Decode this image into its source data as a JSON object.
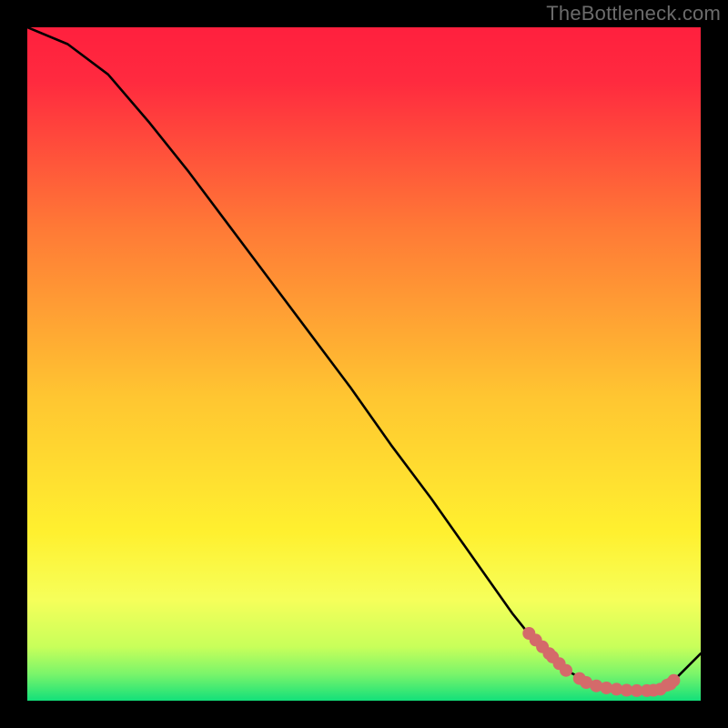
{
  "attribution": "TheBottleneck.com",
  "colors": {
    "gradient_top": "#ff203e",
    "gradient_mid": "#ffd231",
    "gradient_low": "#f6ff5a",
    "gradient_bottom": "#13e07a",
    "curve": "#000000",
    "marker": "#d46a6a",
    "frame": "#000000"
  },
  "chart_data": {
    "type": "line",
    "title": "",
    "xlabel": "",
    "ylabel": "",
    "x_range": [
      0,
      100
    ],
    "y_range": [
      0,
      100
    ],
    "curve": {
      "x": [
        0,
        6,
        12,
        18,
        24,
        30,
        36,
        42,
        48,
        54,
        60,
        66,
        72,
        76,
        80,
        84,
        88,
        92,
        96,
        100
      ],
      "y": [
        100,
        97.5,
        93,
        86,
        78.5,
        70.5,
        62.5,
        54.5,
        46.5,
        38,
        30,
        21.5,
        13,
        8,
        4.5,
        2.5,
        1.5,
        1.5,
        3,
        7
      ]
    },
    "markers": {
      "x": [
        74.5,
        75.5,
        76.5,
        77.5,
        78,
        79,
        80,
        82,
        83,
        84.5,
        86,
        87.5,
        89,
        90.5,
        92,
        93,
        94,
        95,
        96,
        95.5
      ],
      "y": [
        10,
        9,
        8,
        7,
        6.5,
        5.5,
        4.5,
        3.3,
        2.7,
        2.2,
        1.9,
        1.7,
        1.55,
        1.5,
        1.5,
        1.55,
        1.7,
        2.3,
        3,
        2.5
      ]
    }
  }
}
